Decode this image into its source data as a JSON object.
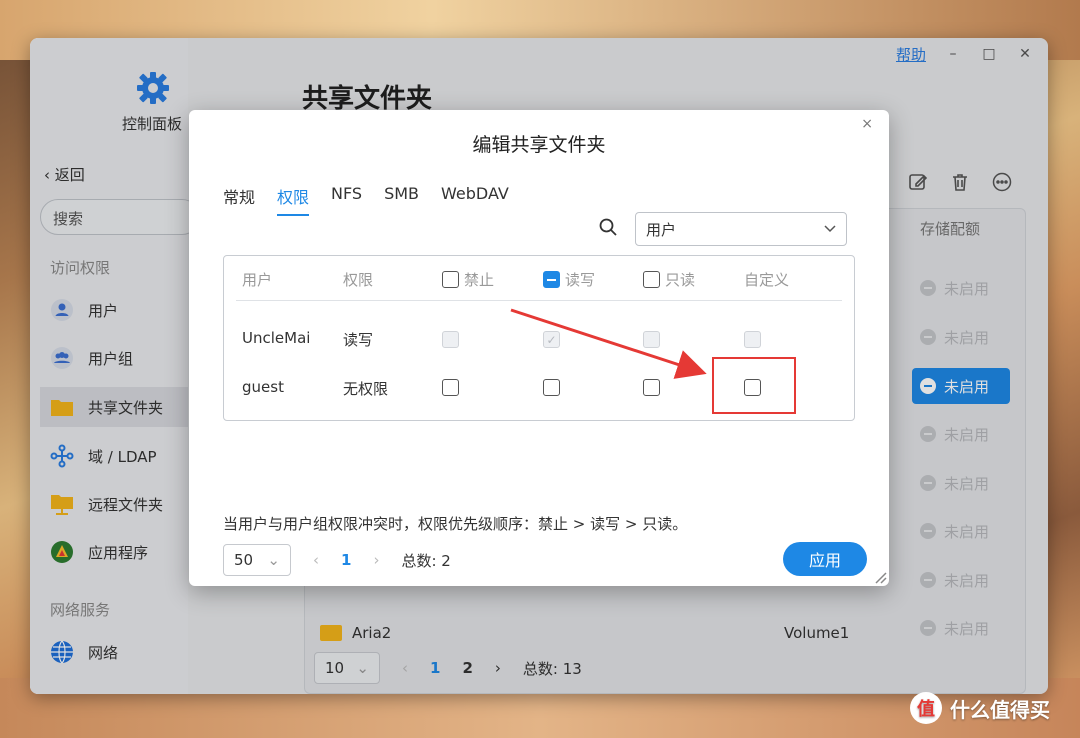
{
  "window": {
    "help": "帮助",
    "minimize": "–",
    "maximize": "□",
    "close": "✕"
  },
  "sidebar": {
    "app_title": "控制面板",
    "back": "返回",
    "search_placeholder": "搜索",
    "section_access": "访问权限",
    "items": [
      {
        "label": "用户",
        "icon": "user-icon"
      },
      {
        "label": "用户组",
        "icon": "user-group-icon"
      },
      {
        "label": "共享文件夹",
        "icon": "folder-icon"
      },
      {
        "label": "域 / LDAP",
        "icon": "domain-icon"
      },
      {
        "label": "远程文件夹",
        "icon": "remote-folder-icon"
      },
      {
        "label": "应用程序",
        "icon": "app-icon"
      }
    ],
    "section_network": "网络服务",
    "network_item": {
      "label": "网络",
      "icon": "globe-icon"
    }
  },
  "main": {
    "title": "共享文件夹",
    "quota_header": "存储配额",
    "status_label": "未启用",
    "aria_row": {
      "name": "Aria2",
      "volume": "Volume1"
    },
    "pager": {
      "size": "10",
      "pages": [
        "1",
        "2"
      ],
      "total": "总数: 13"
    }
  },
  "dialog": {
    "title": "编辑共享文件夹",
    "close": "×",
    "tabs": [
      "常规",
      "权限",
      "NFS",
      "SMB",
      "WebDAV"
    ],
    "filter_value": "用户",
    "headers": {
      "user": "用户",
      "permission": "权限",
      "deny": "禁止",
      "readwrite": "读写",
      "readonly": "只读",
      "custom": "自定义"
    },
    "rows": [
      {
        "user": "UncleMai",
        "permission": "读写"
      },
      {
        "user": "guest",
        "permission": "无权限"
      }
    ],
    "note": "当用户与用户组权限冲突时，权限优先级顺序：禁止 > 读写 > 只读。",
    "pager": {
      "size": "50",
      "page": "1",
      "total": "总数: 2"
    },
    "apply": "应用"
  },
  "watermark": {
    "badge": "值",
    "text": "什么值得买"
  },
  "colors": {
    "accent": "#1e88e5",
    "highlight": "#e53935",
    "folder": "#f3b41b"
  }
}
